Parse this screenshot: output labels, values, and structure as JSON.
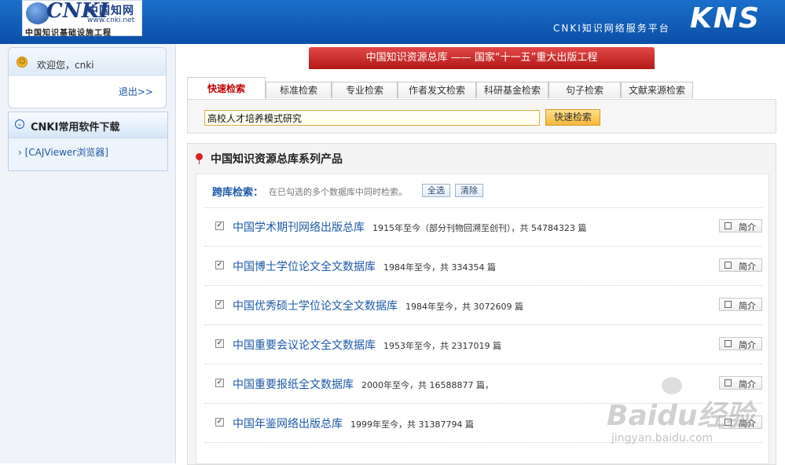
{
  "header": {
    "logo_brand": "CNKI",
    "logo_cn": "中国知网",
    "logo_url": "www.cnki.net",
    "logo_sub": "中国知识基础设施工程",
    "platform": "CNKI知识网络服务平台",
    "kns": "KNS"
  },
  "sidebar": {
    "welcome": "欢迎您，cnki",
    "logout": "退出>>",
    "download_title": "CNKI常用软件下载",
    "download_items": [
      "[CAJViewer浏览器]"
    ]
  },
  "banner": "中国知识资源总库 —— 国家“十一五”重大出版工程",
  "tabs": [
    "快速检索",
    "标准检索",
    "专业检索",
    "作者发文检索",
    "科研基金检索",
    "句子检索",
    "文献来源检索"
  ],
  "search": {
    "value": "高校人才培养模式研究",
    "button": "快速检索"
  },
  "products": {
    "title": "中国知识资源总库系列产品",
    "cross_label": "跨库检索：",
    "cross_hint": "在已勾选的多个数据库中同时检索。",
    "select_all": "全选",
    "clear": "清除",
    "intro_label": "简介",
    "databases": [
      {
        "name": "中国学术期刊网络出版总库",
        "info": "1915年至今（部分刊物回溯至创刊），共 54784323 篇",
        "checked": true
      },
      {
        "name": "中国博士学位论文全文数据库",
        "info": "1984年至今，共 334354 篇",
        "checked": true
      },
      {
        "name": "中国优秀硕士学位论文全文数据库",
        "info": "1984年至今，共 3072609 篇",
        "checked": true
      },
      {
        "name": "中国重要会议论文全文数据库",
        "info": "1953年至今，共 2317019 篇",
        "checked": true
      },
      {
        "name": "中国重要报纸全文数据库",
        "info": "2000年至今，共 16588877 篇，",
        "checked": true
      },
      {
        "name": "中国年鉴网络出版总库",
        "info": "1999年至今，共 31387794 篇",
        "checked": true
      }
    ]
  },
  "watermark": {
    "text": "Baidu经验",
    "url": "jingyan.baidu.com"
  },
  "colors": {
    "header_blue": "#0b4ea8",
    "banner_red": "#c42020",
    "link_blue": "#1c58a8",
    "active_tab": "#c40000"
  }
}
